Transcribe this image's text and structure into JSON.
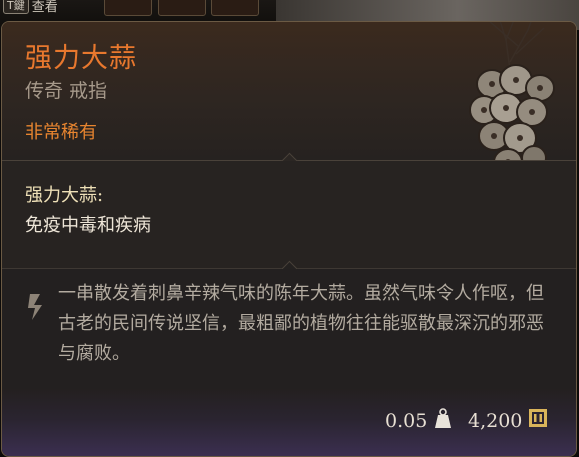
{
  "hud": {
    "key_label": "T鍵",
    "action_label": "查看"
  },
  "item": {
    "name": "强力大蒜",
    "type": "传奇 戒指",
    "rarity": "非常稀有",
    "effect_name": "强力大蒜:",
    "effect_description": "免疫中毒和疾病",
    "lore": "一串散发着刺鼻辛辣气味的陈年大蒜。虽然气味令人作呕，但古老的民间传说坚信，最粗鄙的植物往往能驱散最深沉的邪恶与腐败。",
    "weight": "0.05",
    "price": "4,200"
  },
  "colors": {
    "title": "#e8782e",
    "rarity": "#e8852f",
    "effect_name": "#efe1b8",
    "lore_text": "#b3aba0",
    "border": "#6b5a44",
    "gold": "#d9b45a"
  },
  "icons": {
    "item": "garlic-bulbs-icon",
    "lore": "quote-icon",
    "weight": "weight-icon",
    "price": "gold-coin-icon"
  }
}
